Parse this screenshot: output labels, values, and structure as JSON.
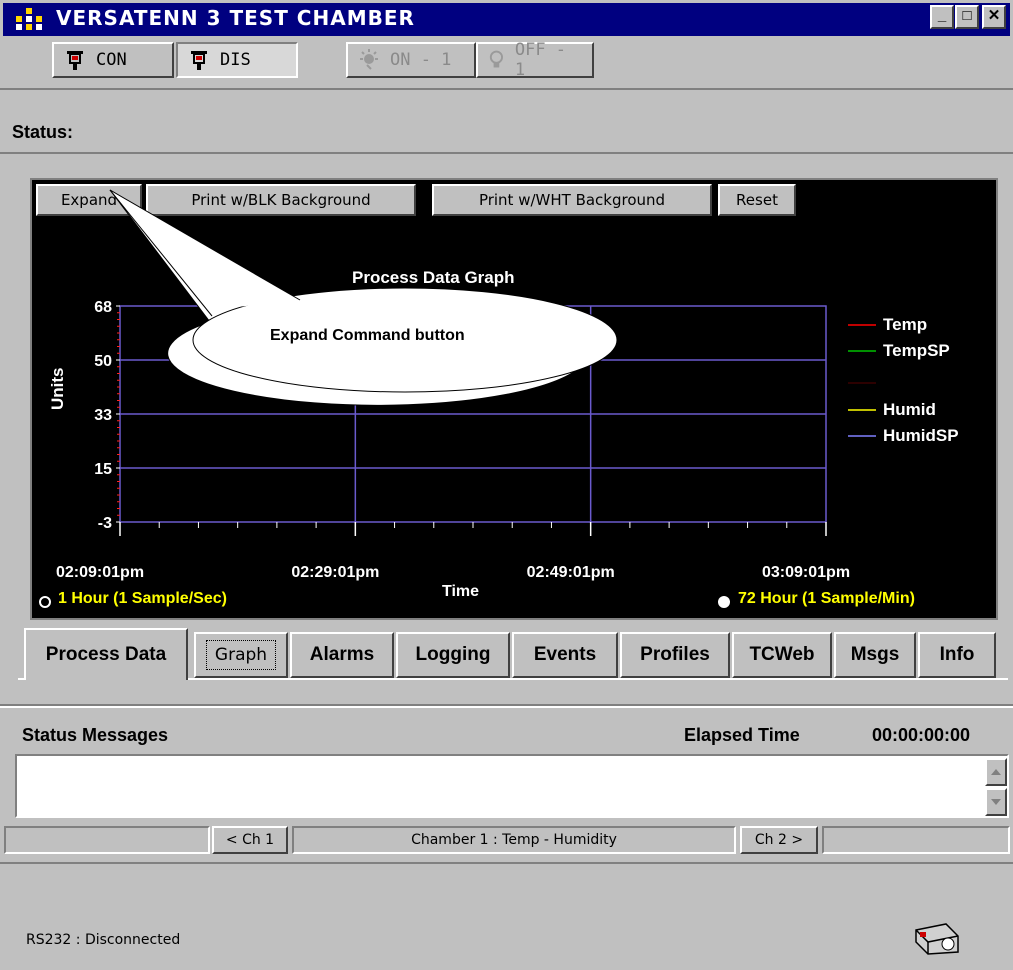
{
  "window": {
    "title": "VERSATENN 3 TEST CHAMBER",
    "minimize": "_",
    "maximize": "□",
    "close": "✕"
  },
  "toolbar": {
    "con_label": "CON",
    "dis_label": "DIS",
    "on_label": "ON - 1",
    "off_label": "OFF - 1"
  },
  "status": {
    "label": "Status:"
  },
  "graph": {
    "buttons": {
      "expand": "Expand",
      "print_blk": "Print w/BLK Background",
      "print_wht": "Print w/WHT Background",
      "reset": "Reset"
    },
    "callout": "Expand Command button",
    "radio_1h": "1 Hour (1 Sample/Sec)",
    "radio_72h": "72 Hour (1 Sample/Min)",
    "colors": {
      "grid": "#6a5acd",
      "Temp": "#ff0000",
      "TempSP": "#00c000",
      "Humid": "#ffff00",
      "HumidSP": "#8080ff"
    }
  },
  "chart_data": {
    "type": "line",
    "title": "Process Data Graph",
    "xlabel": "Time",
    "ylabel": "Units",
    "x_ticks": [
      "02:09:01pm",
      "02:29:01pm",
      "02:49:01pm",
      "03:09:01pm"
    ],
    "y_ticks": [
      "68",
      "50",
      "33",
      "15",
      "-3"
    ],
    "ylim": [
      -3,
      68
    ],
    "grid": true,
    "legend_position": "right",
    "series": [
      {
        "name": "Temp",
        "values": []
      },
      {
        "name": "TempSP",
        "values": []
      },
      {
        "name": "Humid",
        "values": []
      },
      {
        "name": "HumidSP",
        "values": []
      }
    ]
  },
  "tabs": [
    "Process Data",
    "Graph",
    "Alarms",
    "Logging",
    "Events",
    "Profiles",
    "TCWeb",
    "Msgs",
    "Info"
  ],
  "status_panel": {
    "messages_label": "Status Messages",
    "elapsed_label": "Elapsed Time",
    "elapsed_value": "00:00:00:00"
  },
  "channel_bar": {
    "prev": "< Ch 1",
    "chamber": "Chamber 1 : Temp - Humidity",
    "next": "Ch 2 >"
  },
  "footer": {
    "connection": "RS232 : Disconnected"
  }
}
